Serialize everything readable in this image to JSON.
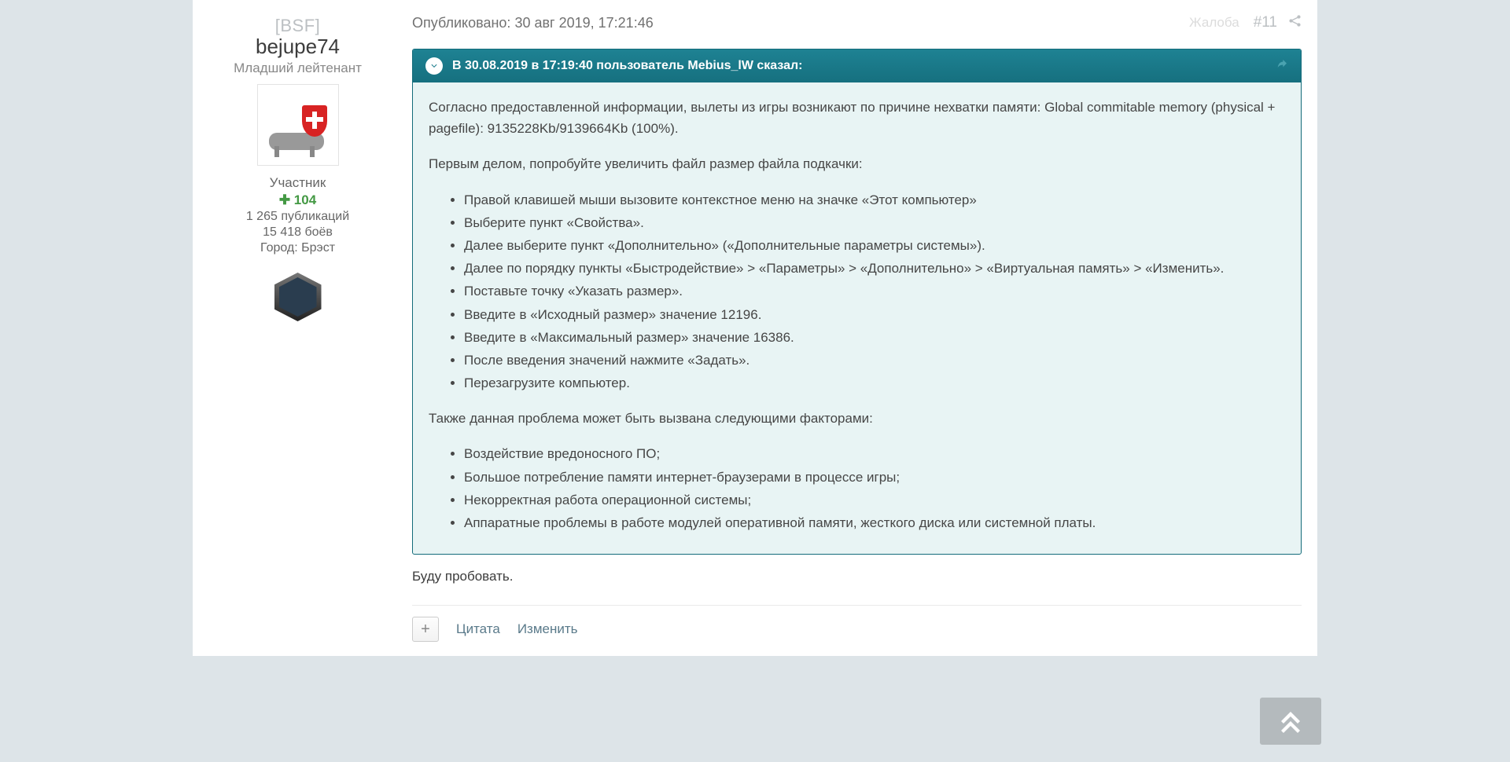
{
  "author": {
    "clan": "[BSF]",
    "username": "bejupe74",
    "rank": "Младший лейтенант",
    "role": "Участник",
    "reputation": "104",
    "posts": "1 265 публикаций",
    "battles": "15 418 боёв",
    "city_label": "Город:",
    "city": "Брэст"
  },
  "meta": {
    "published_label": "Опубликовано:",
    "published_date": "30 авг 2019, 17:21:46",
    "complain": "Жалоба",
    "post_number": "#11"
  },
  "quote": {
    "header": "В 30.08.2019 в 17:19:40 пользователь Mebius_lW сказал:",
    "intro": "Согласно предоставленной информации, вылеты из игры возникают по причине нехватки памяти: Global commitable memory (physical + pagefile): 9135228Kb/9139664Kb (100%).",
    "p2": "Первым делом, попробуйте увеличить файл размер файла подкачки:",
    "steps": [
      "Правой клавишей мыши вызовите контекстное меню на значке «Этот компьютер»",
      "Выберите пункт «Свойства».",
      "Далее выберите пункт «Дополнительно» («Дополнительные параметры системы»).",
      "Далее по порядку пункты «Быстродействие» > «Параметры» > «Дополнительно» > «Виртуальная память» > «Изменить».",
      "Поставьте точку «Указать размер».",
      "Введите в «Исходный размер» значение 12196.",
      "Введите в «Максимальный размер» значение 16386.",
      "После введения значений нажмите «Задать».",
      "Перезагрузите компьютер."
    ],
    "p3": "Также данная проблема может быть вызвана следующими факторами:",
    "factors": [
      "Воздействие вредоносного ПО;",
      "Большое потребление памяти интернет-браузерами в процессе игры;",
      "Некорректная работа операционной системы;",
      "Аппаратные проблемы в работе модулей оперативной памяти, жесткого диска или системной платы."
    ]
  },
  "reply_text": "Буду пробовать.",
  "footer": {
    "plus": "+",
    "quote": "Цитата",
    "edit": "Изменить"
  }
}
